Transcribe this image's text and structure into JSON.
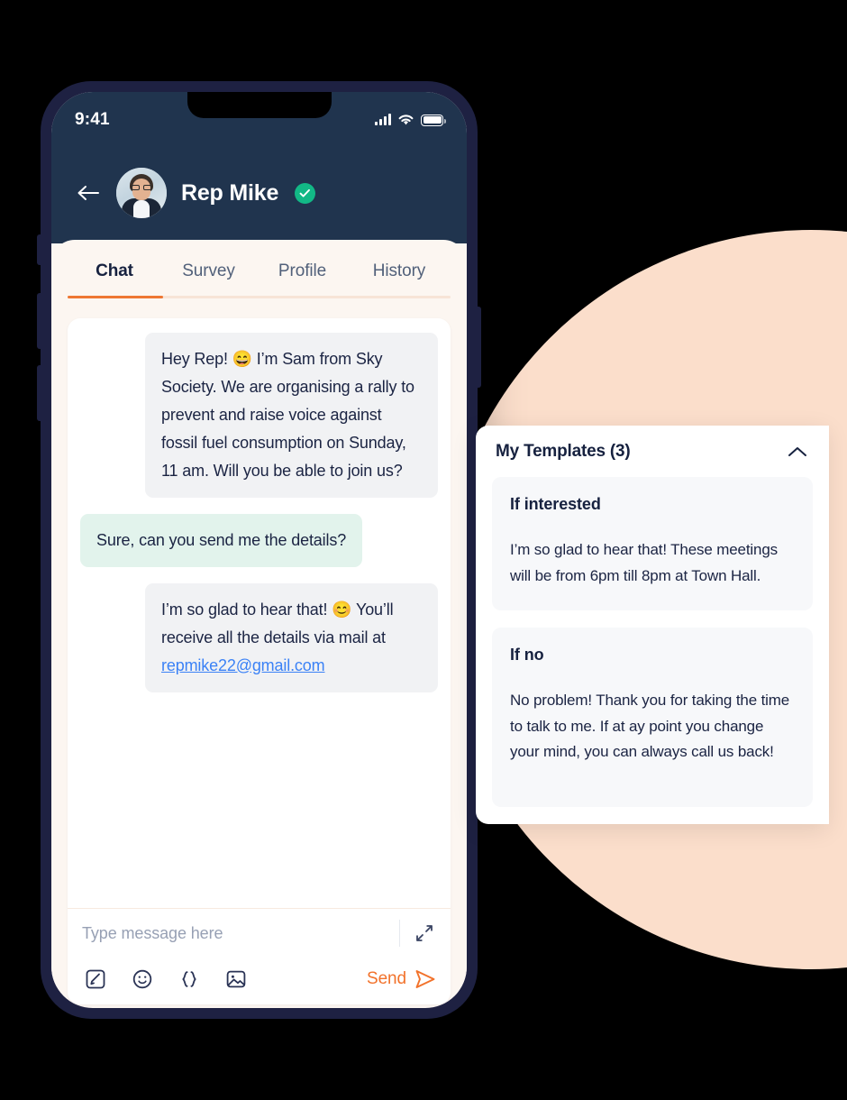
{
  "phone": {
    "status_bar": {
      "clock": "9:41",
      "signal_icon": "signal-bars-icon",
      "wifi_icon": "wifi-icon",
      "battery_icon": "battery-icon"
    },
    "header": {
      "back_icon": "back-arrow-icon",
      "avatar_alt": "avatar",
      "contact_name": "Rep Mike",
      "verified_icon": "verified-check-icon"
    },
    "tabs": [
      {
        "label": "Chat",
        "active": true
      },
      {
        "label": "Survey",
        "active": false
      },
      {
        "label": "Profile",
        "active": false
      },
      {
        "label": "History",
        "active": false
      }
    ],
    "messages": [
      {
        "side": "in",
        "style": "grey",
        "text": "Hey Rep! 😄 I’m Sam from Sky Society. We are organising a rally to prevent and raise voice against fossil fuel consumption on Sunday, 11 am. Will you be able to join us?"
      },
      {
        "side": "out",
        "style": "mint",
        "text": "Sure, can you send me the details?"
      },
      {
        "side": "in",
        "style": "grey",
        "text_before_link": "I’m so glad to hear that! 😊 You’ll receive all the details via mail at ",
        "link_text": "repmike22@gmail.com"
      }
    ],
    "composer": {
      "input_value": "",
      "input_placeholder": "Type message here",
      "expand_icon": "expand-arrows-icon",
      "tools": [
        {
          "icon": "note-edit-icon"
        },
        {
          "icon": "emoji-smiley-icon"
        },
        {
          "icon": "curly-braces-icon"
        },
        {
          "icon": "image-icon"
        }
      ],
      "send_label": "Send",
      "send_icon": "send-paper-plane-icon"
    }
  },
  "templates_panel": {
    "title": "My Templates (3)",
    "collapse_icon": "chevron-up-icon",
    "items": [
      {
        "name": "If interested",
        "body": "I’m so glad to hear that! These meetings will be from 6pm till 8pm at Town Hall."
      },
      {
        "name": "If no",
        "body": "No problem! Thank you for taking the time to talk to me. If at ay point you change your mind, you can always call us back!"
      }
    ]
  },
  "colors": {
    "page_background": "#000000",
    "deco_circle": "#FBDECB",
    "phone_frame": "#1E2142",
    "app_header": "#20344E",
    "screen_background": "#FCF6F1",
    "accent_orange": "#EE7733",
    "send_orange": "#F2722B",
    "verified_teal": "#12B886",
    "bubble_grey": "#F1F2F4",
    "bubble_mint": "#E2F3EC",
    "link_blue": "#3B82F6",
    "template_card": "#F7F8FA",
    "text_dark": "#16213F",
    "text_muted": "#51607A"
  }
}
